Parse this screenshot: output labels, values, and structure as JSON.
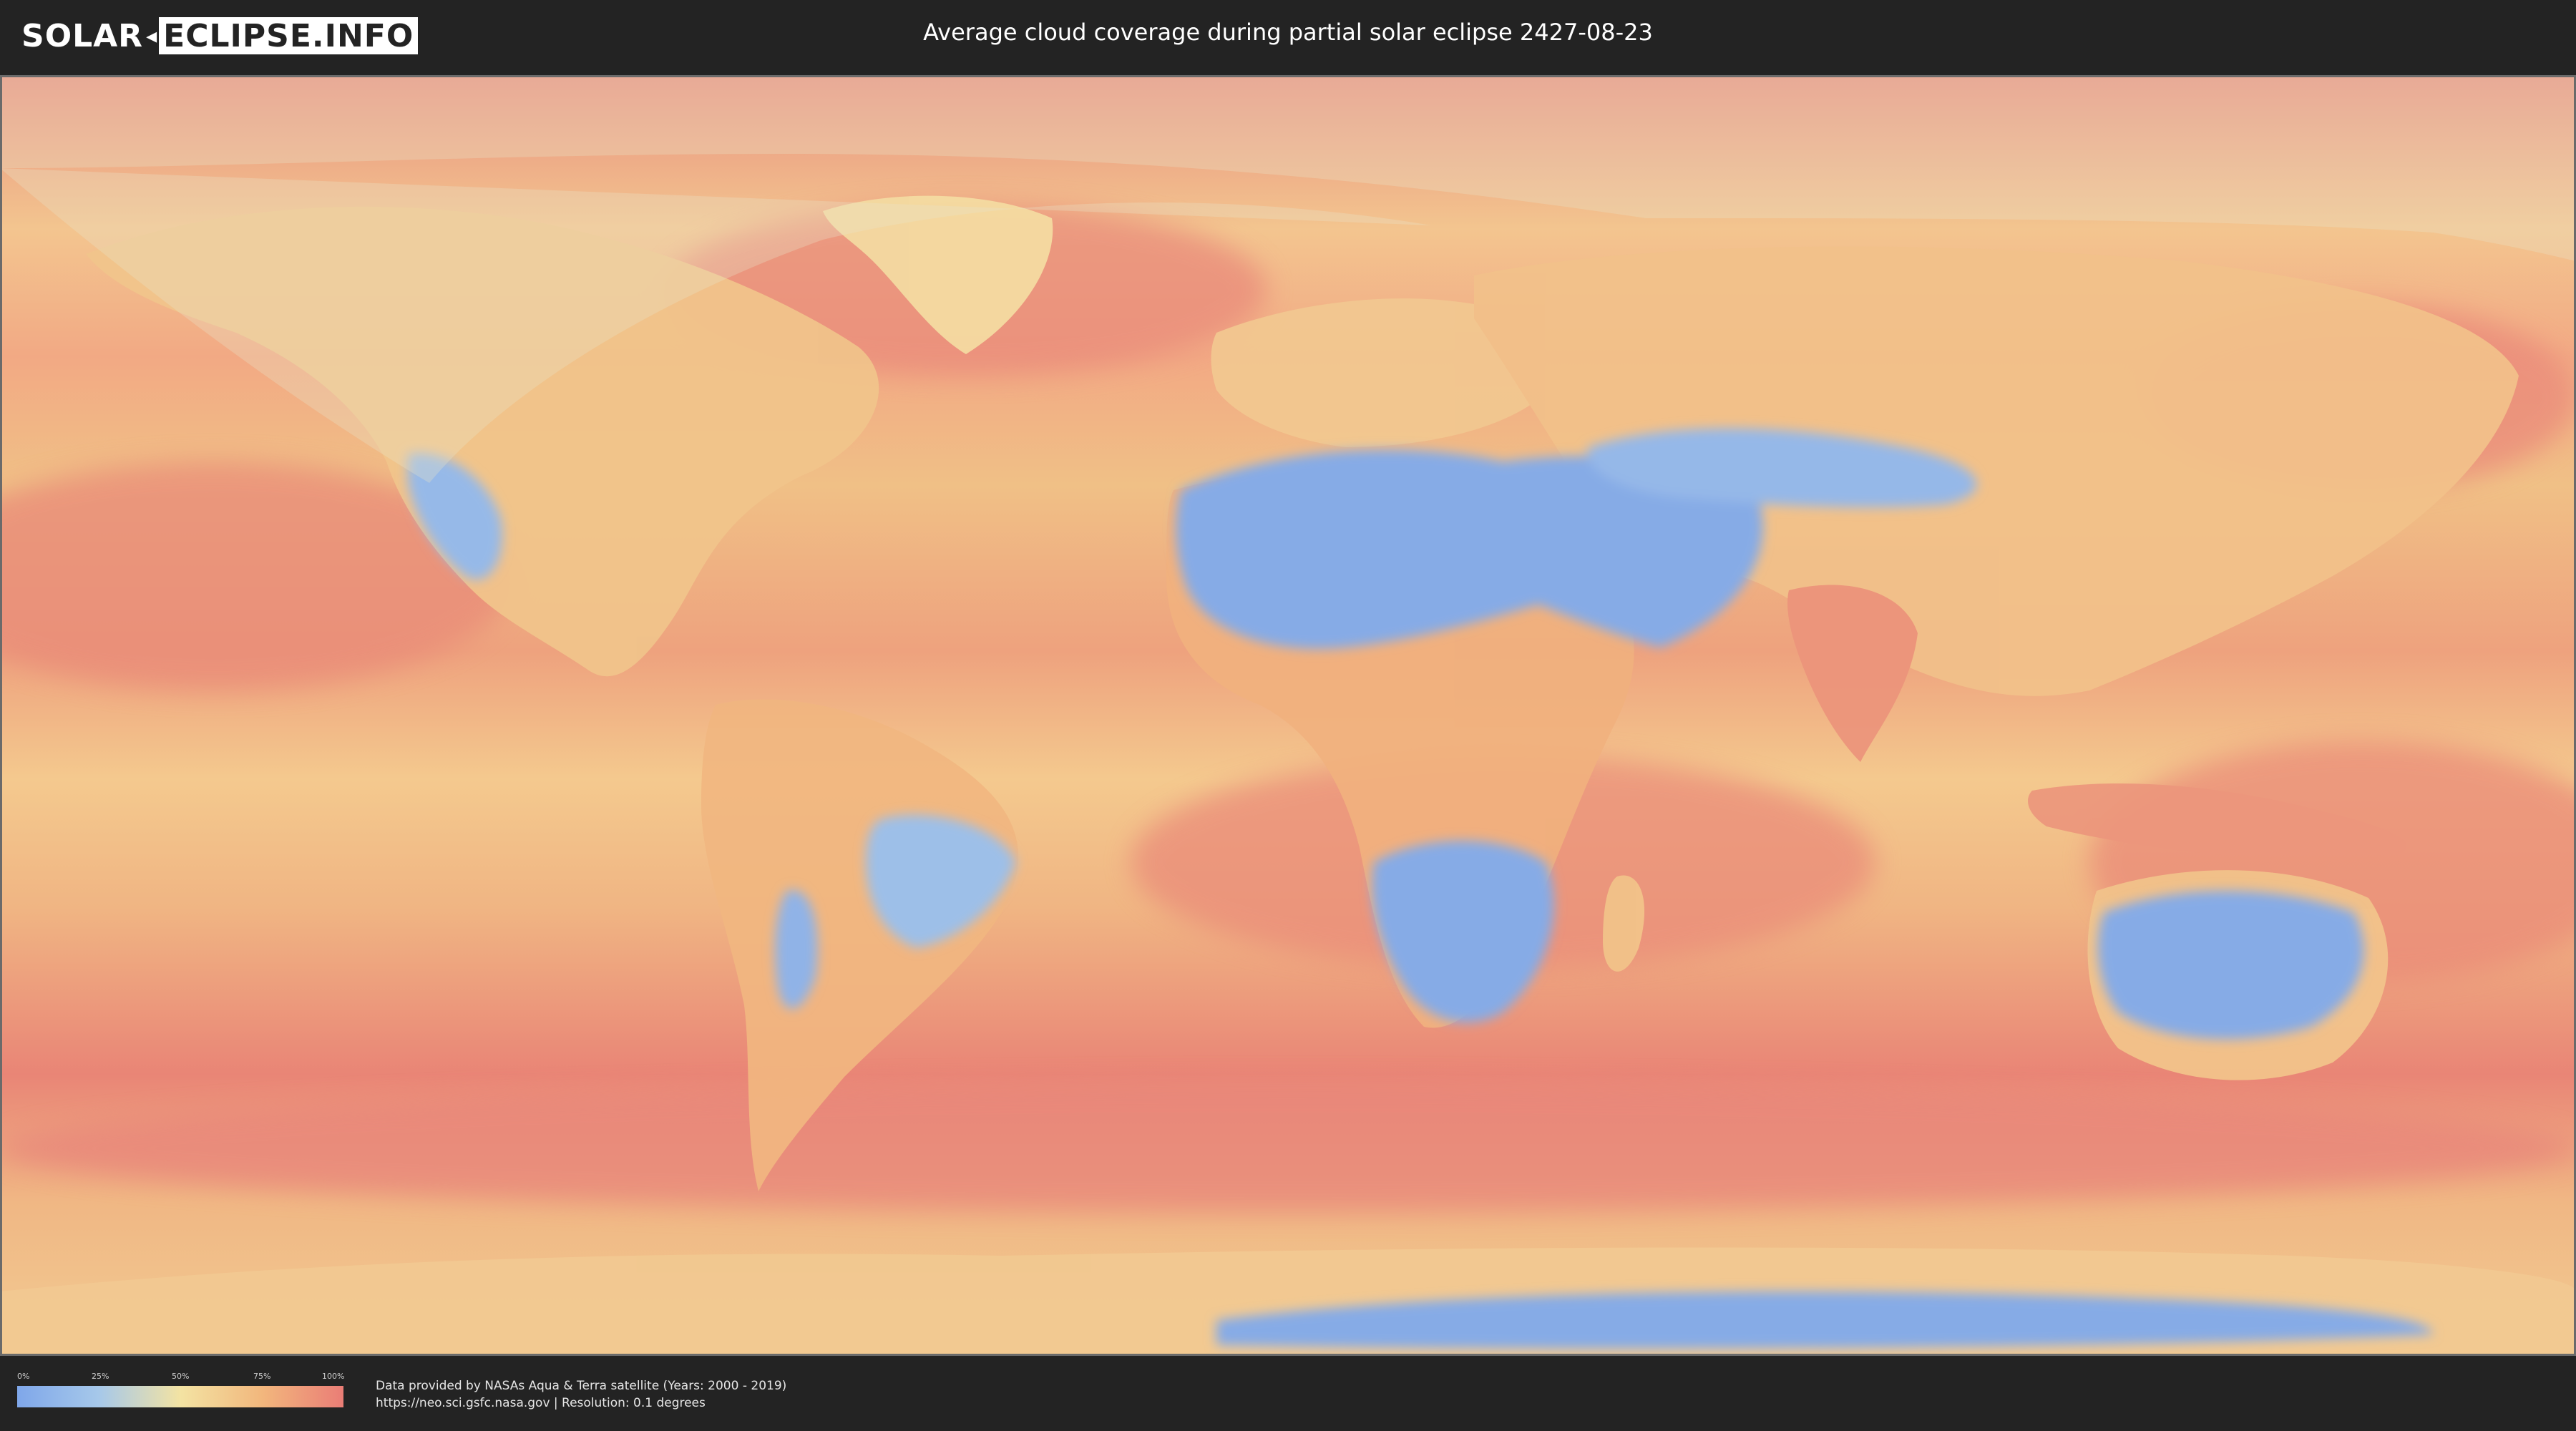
{
  "header": {
    "logo_left": "SOLAR",
    "logo_right": "ECLIPSE.INFO",
    "title": "Average cloud coverage during partial solar eclipse 2427-08-23"
  },
  "legend": {
    "ticks": [
      "0%",
      "25%",
      "50%",
      "75%",
      "100%"
    ],
    "colors": [
      "#7fa7ea",
      "#a6c8ea",
      "#f3e3a3",
      "#f2b77d",
      "#ea7d76"
    ]
  },
  "credits": {
    "line1": "Data provided by NASAs Aqua & Terra satellite (Years: 2000 - 2019)",
    "line2": "https://neo.sci.gsfc.nasa.gov | Resolution: 0.1 degrees"
  },
  "map": {
    "projection": "equirectangular",
    "ocean_color": "#ee9a78",
    "land_cloudy_color": "#f0c08a",
    "clear_sky_color": "#7fa7ea",
    "eclipse_region_color": "#e8e4c8"
  }
}
